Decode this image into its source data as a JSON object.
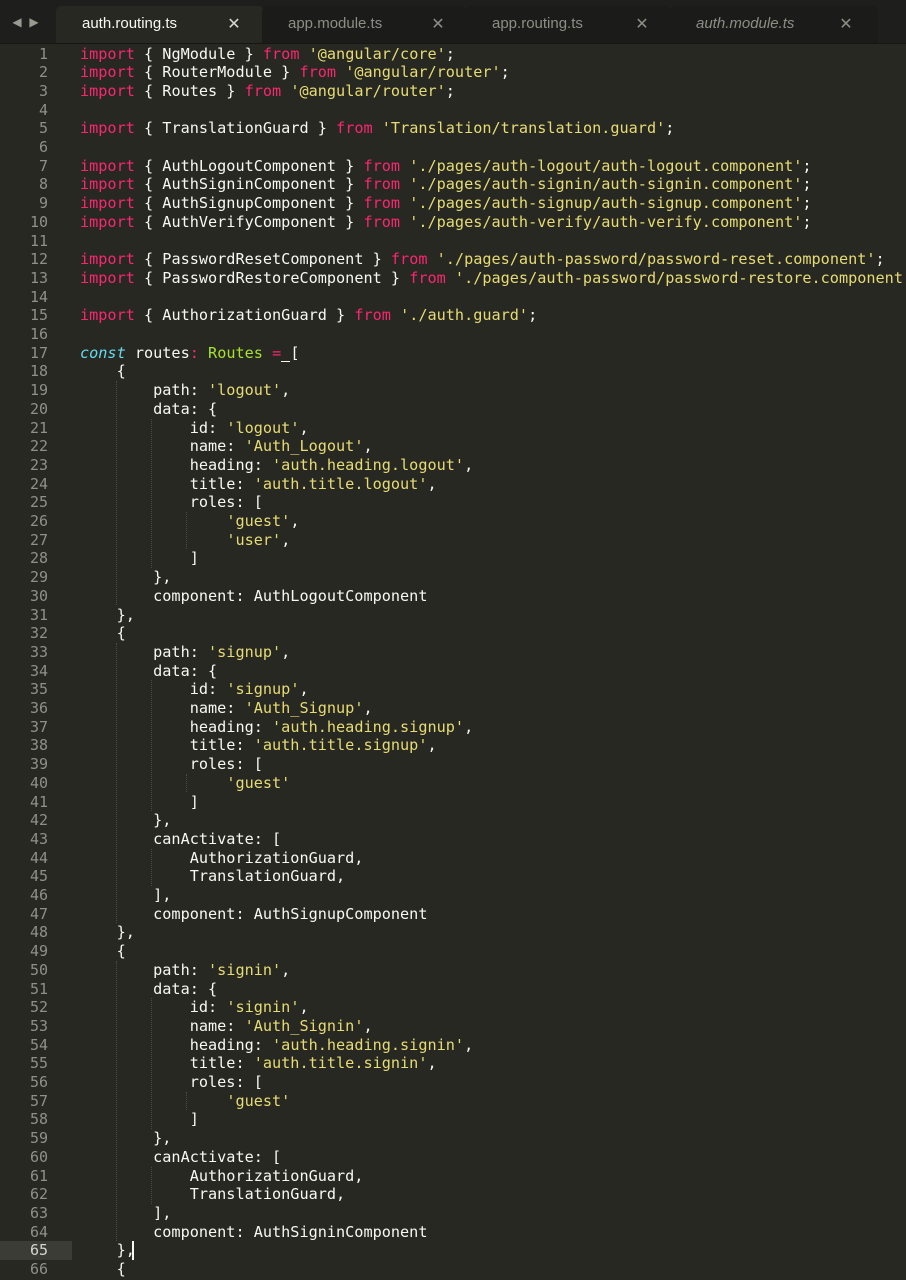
{
  "colors": {
    "background": "#272822",
    "keyword": "#f92672",
    "string": "#e6db74",
    "type": "#a6e22e",
    "storage": "#66d9ef",
    "plain": "#f8f8f2",
    "gutter_text": "#8f908a"
  },
  "nav": {
    "back_icon": "triangle-left-icon",
    "forward_icon": "triangle-right-icon"
  },
  "tabs": [
    {
      "label": "auth.routing.ts",
      "active": true,
      "italic": false,
      "close_icon": "close-icon"
    },
    {
      "label": "app.module.ts",
      "active": false,
      "italic": false,
      "close_icon": "close-icon"
    },
    {
      "label": "app.routing.ts",
      "active": false,
      "italic": false,
      "close_icon": "close-icon"
    },
    {
      "label": "auth.module.ts",
      "active": false,
      "italic": true,
      "close_icon": "close-icon"
    }
  ],
  "editor": {
    "current_line": 65,
    "lines": [
      {
        "n": "1",
        "tokens": [
          [
            "kw",
            "import"
          ],
          [
            "p",
            " { NgModule } "
          ],
          [
            "kw",
            "from"
          ],
          [
            "p",
            " "
          ],
          [
            "str",
            "'@angular/core'"
          ],
          [
            "p",
            ";"
          ]
        ]
      },
      {
        "n": "2",
        "tokens": [
          [
            "kw",
            "import"
          ],
          [
            "p",
            " { RouterModule } "
          ],
          [
            "kw",
            "from"
          ],
          [
            "p",
            " "
          ],
          [
            "str",
            "'@angular/router'"
          ],
          [
            "p",
            ";"
          ]
        ]
      },
      {
        "n": "3",
        "tokens": [
          [
            "kw",
            "import"
          ],
          [
            "p",
            " { Routes } "
          ],
          [
            "kw",
            "from"
          ],
          [
            "p",
            " "
          ],
          [
            "str",
            "'@angular/router'"
          ],
          [
            "p",
            ";"
          ]
        ]
      },
      {
        "n": "4",
        "tokens": []
      },
      {
        "n": "5",
        "tokens": [
          [
            "kw",
            "import"
          ],
          [
            "p",
            " { TranslationGuard } "
          ],
          [
            "kw",
            "from"
          ],
          [
            "p",
            " "
          ],
          [
            "str",
            "'Translation/translation.guard'"
          ],
          [
            "p",
            ";"
          ]
        ]
      },
      {
        "n": "6",
        "tokens": []
      },
      {
        "n": "7",
        "tokens": [
          [
            "kw",
            "import"
          ],
          [
            "p",
            " { AuthLogoutComponent } "
          ],
          [
            "kw",
            "from"
          ],
          [
            "p",
            " "
          ],
          [
            "str",
            "'./pages/auth-logout/auth-logout.component'"
          ],
          [
            "p",
            ";"
          ]
        ]
      },
      {
        "n": "8",
        "tokens": [
          [
            "kw",
            "import"
          ],
          [
            "p",
            " { AuthSigninComponent } "
          ],
          [
            "kw",
            "from"
          ],
          [
            "p",
            " "
          ],
          [
            "str",
            "'./pages/auth-signin/auth-signin.component'"
          ],
          [
            "p",
            ";"
          ]
        ]
      },
      {
        "n": "9",
        "tokens": [
          [
            "kw",
            "import"
          ],
          [
            "p",
            " { AuthSignupComponent } "
          ],
          [
            "kw",
            "from"
          ],
          [
            "p",
            " "
          ],
          [
            "str",
            "'./pages/auth-signup/auth-signup.component'"
          ],
          [
            "p",
            ";"
          ]
        ]
      },
      {
        "n": "10",
        "tokens": [
          [
            "kw",
            "import"
          ],
          [
            "p",
            " { AuthVerifyComponent } "
          ],
          [
            "kw",
            "from"
          ],
          [
            "p",
            " "
          ],
          [
            "str",
            "'./pages/auth-verify/auth-verify.component'"
          ],
          [
            "p",
            ";"
          ]
        ]
      },
      {
        "n": "11",
        "tokens": []
      },
      {
        "n": "12",
        "tokens": [
          [
            "kw",
            "import"
          ],
          [
            "p",
            " { PasswordResetComponent } "
          ],
          [
            "kw",
            "from"
          ],
          [
            "p",
            " "
          ],
          [
            "str",
            "'./pages/auth-password/password-reset.component'"
          ],
          [
            "p",
            ";"
          ]
        ]
      },
      {
        "n": "13",
        "tokens": [
          [
            "kw",
            "import"
          ],
          [
            "p",
            " { PasswordRestoreComponent } "
          ],
          [
            "kw",
            "from"
          ],
          [
            "p",
            " "
          ],
          [
            "str",
            "'./pages/auth-password/password-restore.component'"
          ],
          [
            "p",
            ";"
          ]
        ]
      },
      {
        "n": "14",
        "tokens": []
      },
      {
        "n": "15",
        "tokens": [
          [
            "kw",
            "import"
          ],
          [
            "p",
            " { AuthorizationGuard } "
          ],
          [
            "kw",
            "from"
          ],
          [
            "p",
            " "
          ],
          [
            "str",
            "'./auth.guard'"
          ],
          [
            "p",
            ";"
          ]
        ]
      },
      {
        "n": "16",
        "tokens": []
      },
      {
        "n": "17",
        "tokens": [
          [
            "const",
            "const"
          ],
          [
            "p",
            " routes"
          ],
          [
            "kw",
            ":"
          ],
          [
            "p",
            " "
          ],
          [
            "type",
            "Routes"
          ],
          [
            "p",
            " "
          ],
          [
            "kw",
            "="
          ],
          [
            "p",
            " ["
          ]
        ]
      },
      {
        "n": "18",
        "tokens": [
          [
            "p",
            "    {"
          ]
        ]
      },
      {
        "n": "19",
        "tokens": [
          [
            "p",
            "        path: "
          ],
          [
            "str",
            "'logout'"
          ],
          [
            "p",
            ","
          ]
        ]
      },
      {
        "n": "20",
        "tokens": [
          [
            "p",
            "        data: {"
          ]
        ]
      },
      {
        "n": "21",
        "tokens": [
          [
            "p",
            "            id: "
          ],
          [
            "str",
            "'logout'"
          ],
          [
            "p",
            ","
          ]
        ]
      },
      {
        "n": "22",
        "tokens": [
          [
            "p",
            "            name: "
          ],
          [
            "str",
            "'Auth_Logout'"
          ],
          [
            "p",
            ","
          ]
        ]
      },
      {
        "n": "23",
        "tokens": [
          [
            "p",
            "            heading: "
          ],
          [
            "str",
            "'auth.heading.logout'"
          ],
          [
            "p",
            ","
          ]
        ]
      },
      {
        "n": "24",
        "tokens": [
          [
            "p",
            "            title: "
          ],
          [
            "str",
            "'auth.title.logout'"
          ],
          [
            "p",
            ","
          ]
        ]
      },
      {
        "n": "25",
        "tokens": [
          [
            "p",
            "            roles: ["
          ]
        ]
      },
      {
        "n": "26",
        "tokens": [
          [
            "p",
            "                "
          ],
          [
            "str",
            "'guest'"
          ],
          [
            "p",
            ","
          ]
        ]
      },
      {
        "n": "27",
        "tokens": [
          [
            "p",
            "                "
          ],
          [
            "str",
            "'user'"
          ],
          [
            "p",
            ","
          ]
        ]
      },
      {
        "n": "28",
        "tokens": [
          [
            "p",
            "            ]"
          ]
        ]
      },
      {
        "n": "29",
        "tokens": [
          [
            "p",
            "        },"
          ]
        ]
      },
      {
        "n": "30",
        "tokens": [
          [
            "p",
            "        component: AuthLogoutComponent"
          ]
        ]
      },
      {
        "n": "31",
        "tokens": [
          [
            "p",
            "    },"
          ]
        ]
      },
      {
        "n": "32",
        "tokens": [
          [
            "p",
            "    {"
          ]
        ]
      },
      {
        "n": "33",
        "tokens": [
          [
            "p",
            "        path: "
          ],
          [
            "str",
            "'signup'"
          ],
          [
            "p",
            ","
          ]
        ]
      },
      {
        "n": "34",
        "tokens": [
          [
            "p",
            "        data: {"
          ]
        ]
      },
      {
        "n": "35",
        "tokens": [
          [
            "p",
            "            id: "
          ],
          [
            "str",
            "'signup'"
          ],
          [
            "p",
            ","
          ]
        ]
      },
      {
        "n": "36",
        "tokens": [
          [
            "p",
            "            name: "
          ],
          [
            "str",
            "'Auth_Signup'"
          ],
          [
            "p",
            ","
          ]
        ]
      },
      {
        "n": "37",
        "tokens": [
          [
            "p",
            "            heading: "
          ],
          [
            "str",
            "'auth.heading.signup'"
          ],
          [
            "p",
            ","
          ]
        ]
      },
      {
        "n": "38",
        "tokens": [
          [
            "p",
            "            title: "
          ],
          [
            "str",
            "'auth.title.signup'"
          ],
          [
            "p",
            ","
          ]
        ]
      },
      {
        "n": "39",
        "tokens": [
          [
            "p",
            "            roles: ["
          ]
        ]
      },
      {
        "n": "40",
        "tokens": [
          [
            "p",
            "                "
          ],
          [
            "str",
            "'guest'"
          ]
        ]
      },
      {
        "n": "41",
        "tokens": [
          [
            "p",
            "            ]"
          ]
        ]
      },
      {
        "n": "42",
        "tokens": [
          [
            "p",
            "        },"
          ]
        ]
      },
      {
        "n": "43",
        "tokens": [
          [
            "p",
            "        canActivate: ["
          ]
        ]
      },
      {
        "n": "44",
        "tokens": [
          [
            "p",
            "            AuthorizationGuard,"
          ]
        ]
      },
      {
        "n": "45",
        "tokens": [
          [
            "p",
            "            TranslationGuard,"
          ]
        ]
      },
      {
        "n": "46",
        "tokens": [
          [
            "p",
            "        ],"
          ]
        ]
      },
      {
        "n": "47",
        "tokens": [
          [
            "p",
            "        component: AuthSignupComponent"
          ]
        ]
      },
      {
        "n": "48",
        "tokens": [
          [
            "p",
            "    },"
          ]
        ]
      },
      {
        "n": "49",
        "tokens": [
          [
            "p",
            "    {"
          ]
        ]
      },
      {
        "n": "50",
        "tokens": [
          [
            "p",
            "        path: "
          ],
          [
            "str",
            "'signin'"
          ],
          [
            "p",
            ","
          ]
        ]
      },
      {
        "n": "51",
        "tokens": [
          [
            "p",
            "        data: {"
          ]
        ]
      },
      {
        "n": "52",
        "tokens": [
          [
            "p",
            "            id: "
          ],
          [
            "str",
            "'signin'"
          ],
          [
            "p",
            ","
          ]
        ]
      },
      {
        "n": "53",
        "tokens": [
          [
            "p",
            "            name: "
          ],
          [
            "str",
            "'Auth_Signin'"
          ],
          [
            "p",
            ","
          ]
        ]
      },
      {
        "n": "54",
        "tokens": [
          [
            "p",
            "            heading: "
          ],
          [
            "str",
            "'auth.heading.signin'"
          ],
          [
            "p",
            ","
          ]
        ]
      },
      {
        "n": "55",
        "tokens": [
          [
            "p",
            "            title: "
          ],
          [
            "str",
            "'auth.title.signin'"
          ],
          [
            "p",
            ","
          ]
        ]
      },
      {
        "n": "56",
        "tokens": [
          [
            "p",
            "            roles: ["
          ]
        ]
      },
      {
        "n": "57",
        "tokens": [
          [
            "p",
            "                "
          ],
          [
            "str",
            "'guest'"
          ]
        ]
      },
      {
        "n": "58",
        "tokens": [
          [
            "p",
            "            ]"
          ]
        ]
      },
      {
        "n": "59",
        "tokens": [
          [
            "p",
            "        },"
          ]
        ]
      },
      {
        "n": "60",
        "tokens": [
          [
            "p",
            "        canActivate: ["
          ]
        ]
      },
      {
        "n": "61",
        "tokens": [
          [
            "p",
            "            AuthorizationGuard,"
          ]
        ]
      },
      {
        "n": "62",
        "tokens": [
          [
            "p",
            "            TranslationGuard,"
          ]
        ]
      },
      {
        "n": "63",
        "tokens": [
          [
            "p",
            "        ],"
          ]
        ]
      },
      {
        "n": "64",
        "tokens": [
          [
            "p",
            "        component: AuthSigninComponent"
          ]
        ]
      },
      {
        "n": "65",
        "tokens": [
          [
            "p",
            "    },"
          ]
        ]
      },
      {
        "n": "66",
        "tokens": [
          [
            "p",
            "    {"
          ]
        ]
      }
    ]
  }
}
